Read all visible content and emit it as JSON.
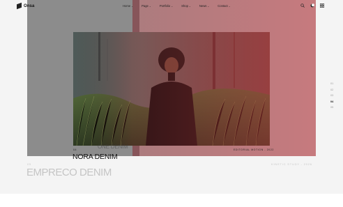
{
  "brand": {
    "name": "Onsa"
  },
  "nav": {
    "items": [
      {
        "label": "Home"
      },
      {
        "label": "Page"
      },
      {
        "label": "Portfolio"
      },
      {
        "label": "Shop"
      },
      {
        "label": "News"
      },
      {
        "label": "Contact"
      }
    ]
  },
  "tools": {
    "icons": [
      "search-icon",
      "moon-icon",
      "grid-icon"
    ]
  },
  "slide_active": {
    "index": "04",
    "meta": "EDITORIAL MOTION - 2022",
    "title": "NORA DENIM",
    "ghost_title": "ONE DENIM"
  },
  "slide_next": {
    "index": "05",
    "meta": "KINETIC STUDY - 2026",
    "title": "EMPRECO DENIM"
  },
  "pagination": {
    "items": [
      "01",
      "02",
      "03",
      "04",
      "05"
    ],
    "active": "04"
  },
  "colors": {
    "panel_gray": "#8c8c8c",
    "panel_pink": "#c9787d",
    "background": "#f4f4f4"
  }
}
